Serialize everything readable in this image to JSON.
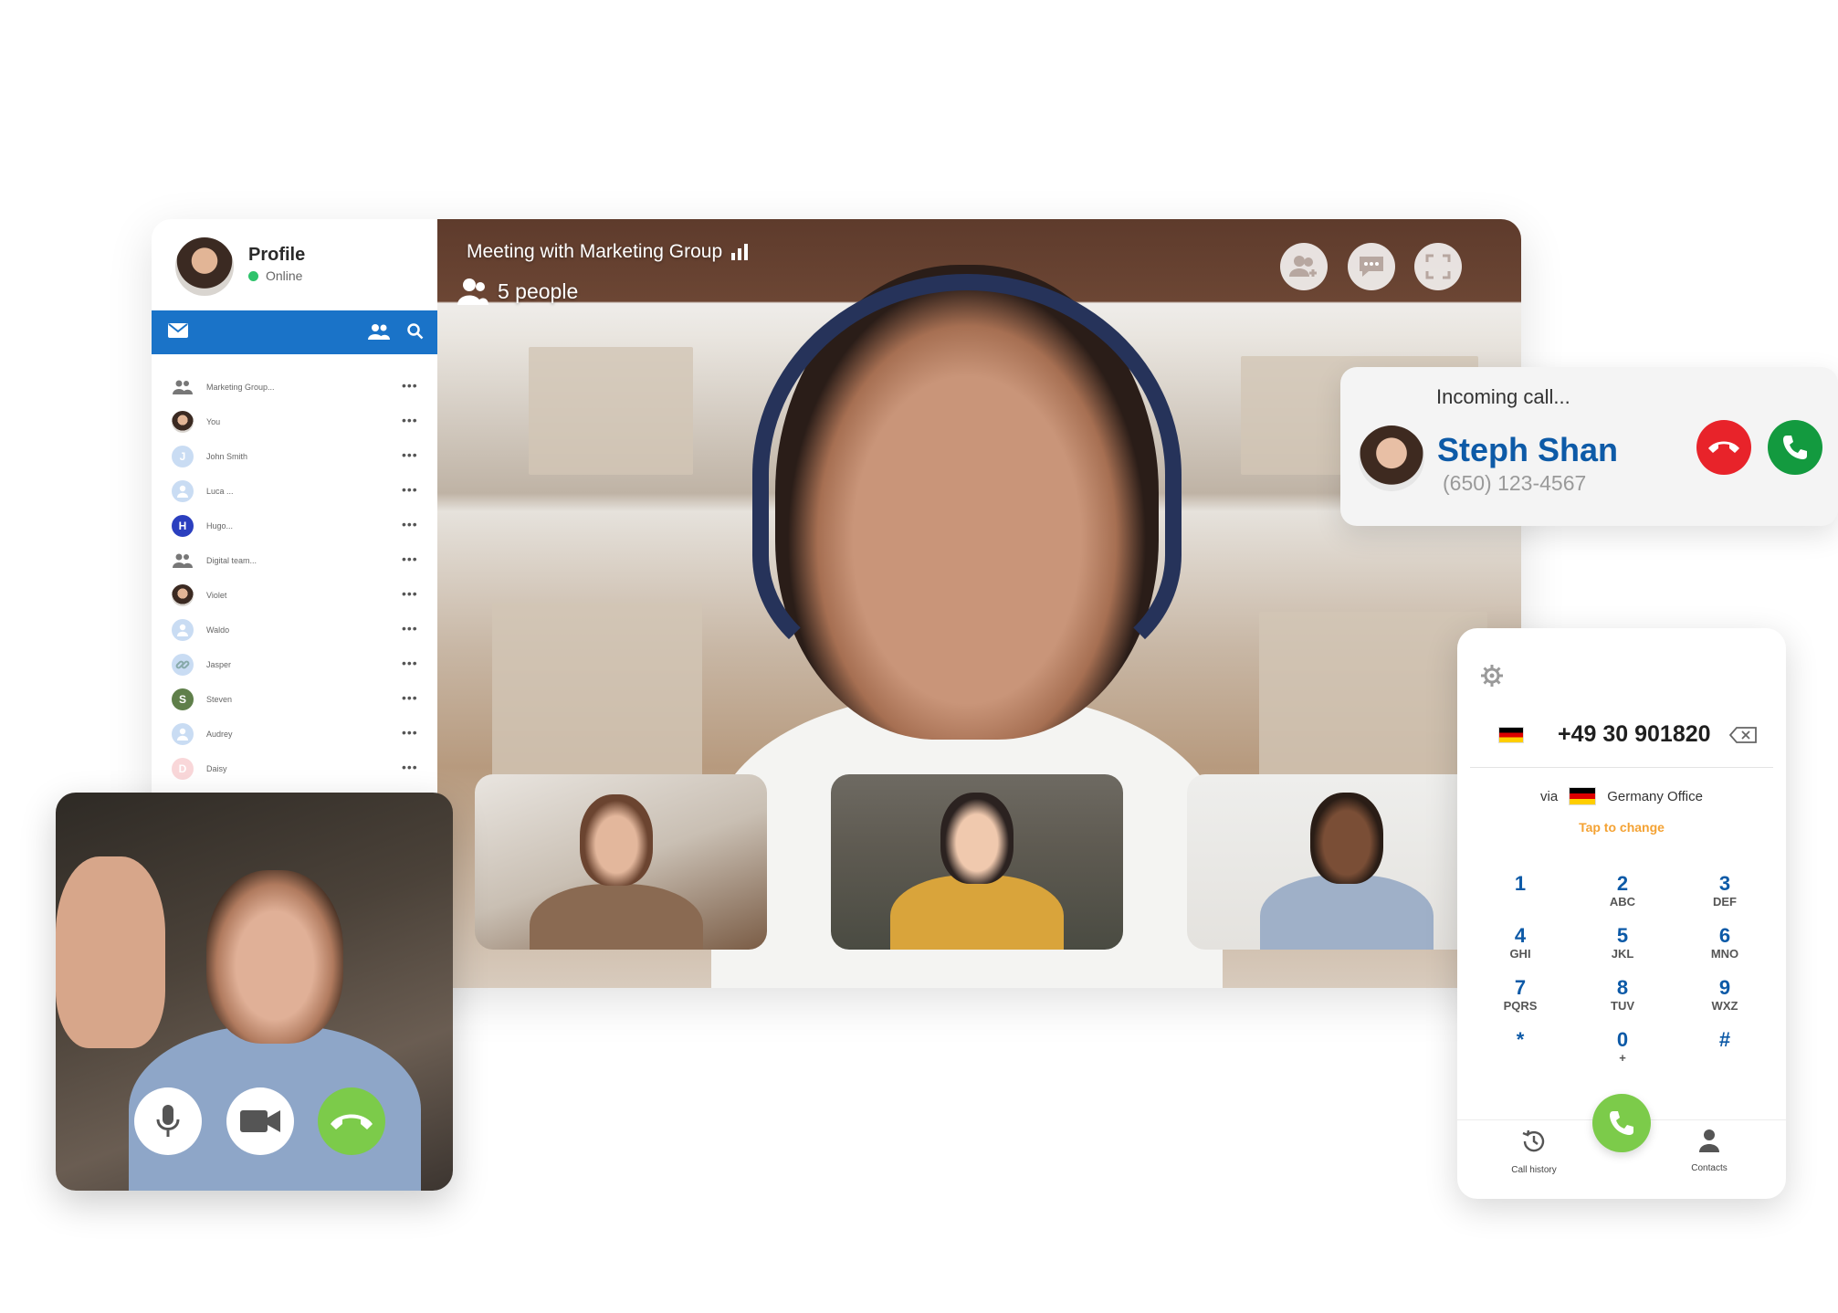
{
  "profile": {
    "title": "Profile",
    "status": "Online"
  },
  "sidebar": {
    "contacts": [
      {
        "name": "Marketing Group...",
        "avatar": "group-icon"
      },
      {
        "name": "You",
        "avatar": "photo"
      },
      {
        "name": "John Smith",
        "initial": "J",
        "color": "#c9dcf3"
      },
      {
        "name": "Luca ...",
        "avatar": "person-icon",
        "color": "#c9dcf3"
      },
      {
        "name": "Hugo...",
        "initial": "H",
        "color": "#2b3fbf"
      },
      {
        "name": "Digital team...",
        "avatar": "group-icon"
      },
      {
        "name": "Violet",
        "avatar": "photo"
      },
      {
        "name": "Waldo",
        "avatar": "person-icon",
        "color": "#c9dcf3"
      },
      {
        "name": "Jasper",
        "avatar": "link-icon",
        "color": "#c9dcf3"
      },
      {
        "name": "Steven",
        "initial": "S",
        "color": "#5f7f4a"
      },
      {
        "name": "Audrey",
        "avatar": "person-icon",
        "color": "#c9dcf3"
      },
      {
        "name": "Daisy",
        "initial": "D",
        "color": "#f9d7d9"
      }
    ],
    "more_label": "•••"
  },
  "meeting": {
    "title": "Meeting with Marketing Group",
    "people": "5 people",
    "buttons": [
      "add-people-icon",
      "chat-icon",
      "fullscreen-icon"
    ]
  },
  "incoming_call": {
    "label": "Incoming call...",
    "name": "Steph Shan",
    "number": "(650) 123-4567",
    "decline_color": "#e8232a",
    "accept_color": "#139a3f"
  },
  "dialer": {
    "number": "+49 30 901820",
    "via": "via",
    "office": "Germany Office",
    "tap_change": "Tap to change",
    "keys": [
      {
        "d": "1",
        "l": ""
      },
      {
        "d": "2",
        "l": "ABC"
      },
      {
        "d": "3",
        "l": "DEF"
      },
      {
        "d": "4",
        "l": "GHI"
      },
      {
        "d": "5",
        "l": "JKL"
      },
      {
        "d": "6",
        "l": "MNO"
      },
      {
        "d": "7",
        "l": "PQRS"
      },
      {
        "d": "8",
        "l": "TUV"
      },
      {
        "d": "9",
        "l": "WXZ"
      },
      {
        "d": "*",
        "l": ""
      },
      {
        "d": "0",
        "l": "+"
      },
      {
        "d": "#",
        "l": ""
      }
    ],
    "call_history": "Call history",
    "contacts": "Contacts",
    "accent": "#0d5aa7",
    "call_color": "#7ccb4a"
  },
  "self_view": {
    "buttons": [
      "microphone-icon",
      "video-camera-icon",
      "hang-up-icon"
    ],
    "hangup_color": "#7ccb4a"
  }
}
